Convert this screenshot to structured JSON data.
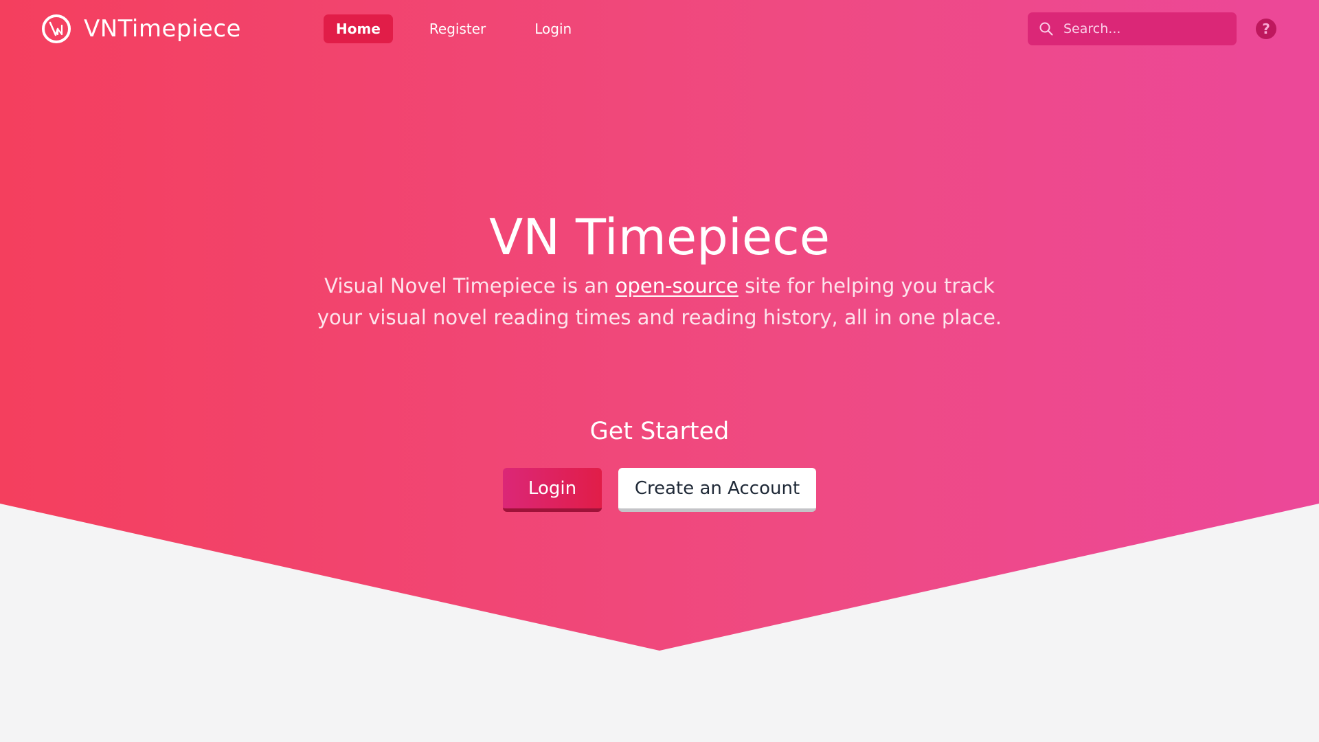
{
  "navbar": {
    "brand_name": "VNTimepiece",
    "links": [
      {
        "label": "Home",
        "active": true
      },
      {
        "label": "Register",
        "active": false
      },
      {
        "label": "Login",
        "active": false
      }
    ],
    "search": {
      "placeholder": "Search...",
      "value": ""
    },
    "help_label": "?"
  },
  "hero": {
    "title": "VN Timepiece",
    "subtitle_before": "Visual Novel Timepiece is an ",
    "subtitle_link": "open-source",
    "subtitle_after": " site for helping you track your visual novel reading times and reading history, all in one place.",
    "get_started": "Get Started",
    "login_button": "Login",
    "create_account_button": "Create an Account"
  },
  "icons": {
    "brand": "vn-clock-logo-icon",
    "search": "search-icon",
    "help": "question-circle-icon"
  },
  "colors": {
    "gradient_start": "#f43f5e",
    "gradient_end": "#ec4899",
    "nav_active": "#e11d48",
    "search_bg": "#db2777",
    "page_bg": "#f4f4f5"
  }
}
